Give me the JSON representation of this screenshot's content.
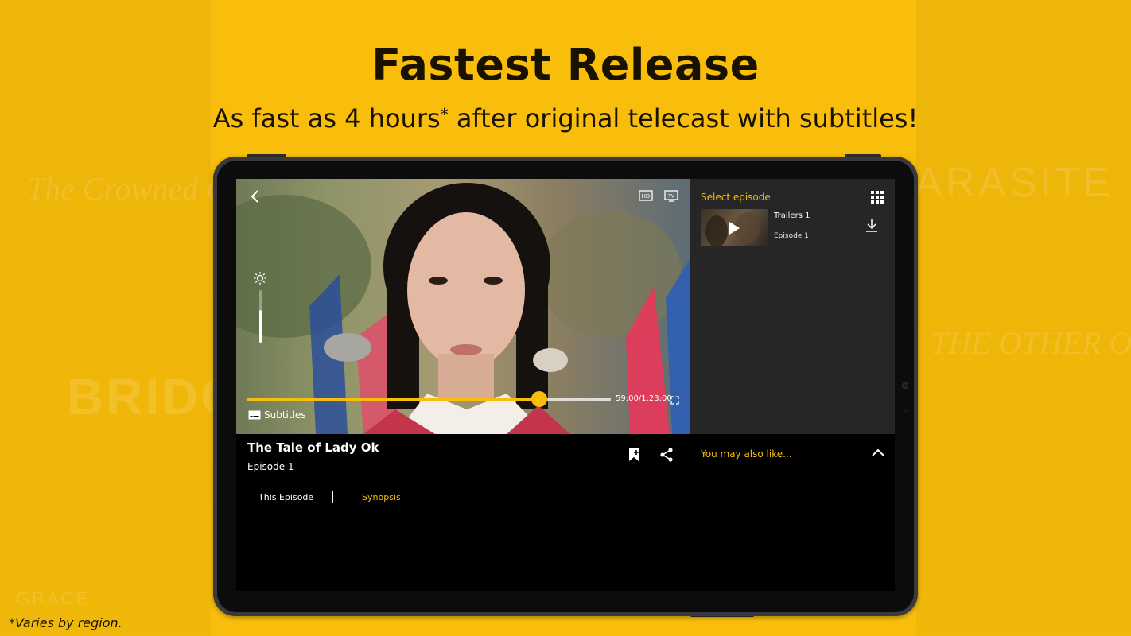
{
  "marketing": {
    "headline": "Fastest Release",
    "subline_before": "As fast as 4 hours",
    "subline_star": "*",
    "subline_after": " after original telecast with subtitles!",
    "footnote": "*Varies by region."
  },
  "background_posters": [
    "The Crowned Cl",
    "BRIDG",
    "ARASITE",
    "THE OTHER ONE",
    "GRACE"
  ],
  "player": {
    "current_time": "59:00",
    "total_time": "1:23:00",
    "time_separator": "/",
    "progress_fraction": 0.803,
    "brightness_fraction": 0.62,
    "subtitles_label": "Subtitles",
    "hd_badge": "HD",
    "tv_badge": "TV"
  },
  "episode_panel": {
    "title": "Select episode",
    "items": [
      {
        "title": "Trailers 1",
        "subtitle": "Episode 1"
      }
    ]
  },
  "show": {
    "title": "The Tale of Lady Ok",
    "episode": "Episode 1"
  },
  "tabs": [
    {
      "label": "This Episode",
      "active": true
    },
    {
      "label": "Synopsis",
      "active": false
    }
  ],
  "recommendations": {
    "label": "You may also like..."
  },
  "colors": {
    "accent": "#f8be0b",
    "background": "#f8be0b",
    "panel": "#262626"
  }
}
